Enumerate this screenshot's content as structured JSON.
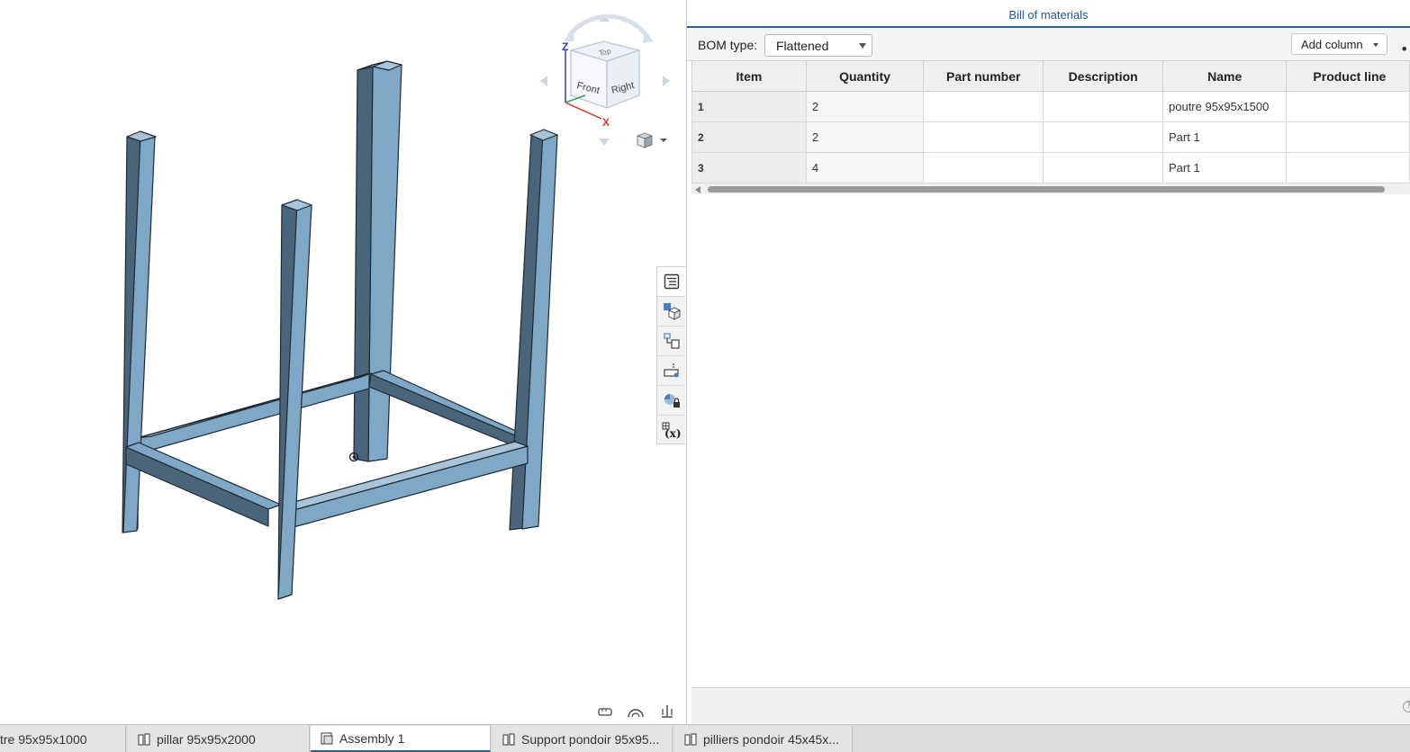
{
  "viewcube": {
    "faces": {
      "top": "Top",
      "front": "Front",
      "right": "Right"
    },
    "axes": {
      "z": "Z",
      "x": "X"
    },
    "axis_colors": {
      "z": "#2d3bd1",
      "x": "#d13a2d"
    }
  },
  "viewport_tools": {
    "vertical": [
      {
        "icon": "bom-list-icon",
        "active": true
      },
      {
        "icon": "instance-cube-icon"
      },
      {
        "icon": "mate-connector-icon"
      },
      {
        "icon": "insert-part-icon"
      },
      {
        "icon": "appearance-lock-icon"
      },
      {
        "icon": "variables-icon"
      }
    ],
    "bottom": [
      "measure-tool-icon",
      "mass-properties-icon",
      "section-view-icon"
    ]
  },
  "bom": {
    "title": "Bill of materials",
    "type_label": "BOM type:",
    "type_value": "Flattened",
    "add_column_label": "Add column",
    "more_label": "••",
    "columns": [
      "Item",
      "Quantity",
      "Part number",
      "Description",
      "Name",
      "Product line"
    ],
    "rows": [
      {
        "item": "1",
        "quantity": "2",
        "part_number": "",
        "description": "",
        "name": "poutre 95x95x1500",
        "product_line": ""
      },
      {
        "item": "2",
        "quantity": "2",
        "part_number": "",
        "description": "",
        "name": "Part 1",
        "product_line": ""
      },
      {
        "item": "3",
        "quantity": "4",
        "part_number": "",
        "description": "",
        "name": "Part 1",
        "product_line": ""
      }
    ],
    "help_label": "?"
  },
  "tabs": [
    {
      "label": "tre 95x95x1000",
      "icon": "part-studio-icon",
      "active": false
    },
    {
      "label": "pillar 95x95x2000",
      "icon": "part-studio-icon",
      "active": false
    },
    {
      "label": "Assembly 1",
      "icon": "assembly-icon",
      "active": true
    },
    {
      "label": "Support pondoir 95x95...",
      "icon": "part-studio-icon",
      "active": false
    },
    {
      "label": "pilliers pondoir 45x45x...",
      "icon": "part-studio-icon",
      "active": false
    }
  ],
  "colors": {
    "accent": "#2b5d9f",
    "part_light": "#7fa7c6",
    "part_dark": "#4a6579",
    "part_top": "#a9c3d8"
  }
}
